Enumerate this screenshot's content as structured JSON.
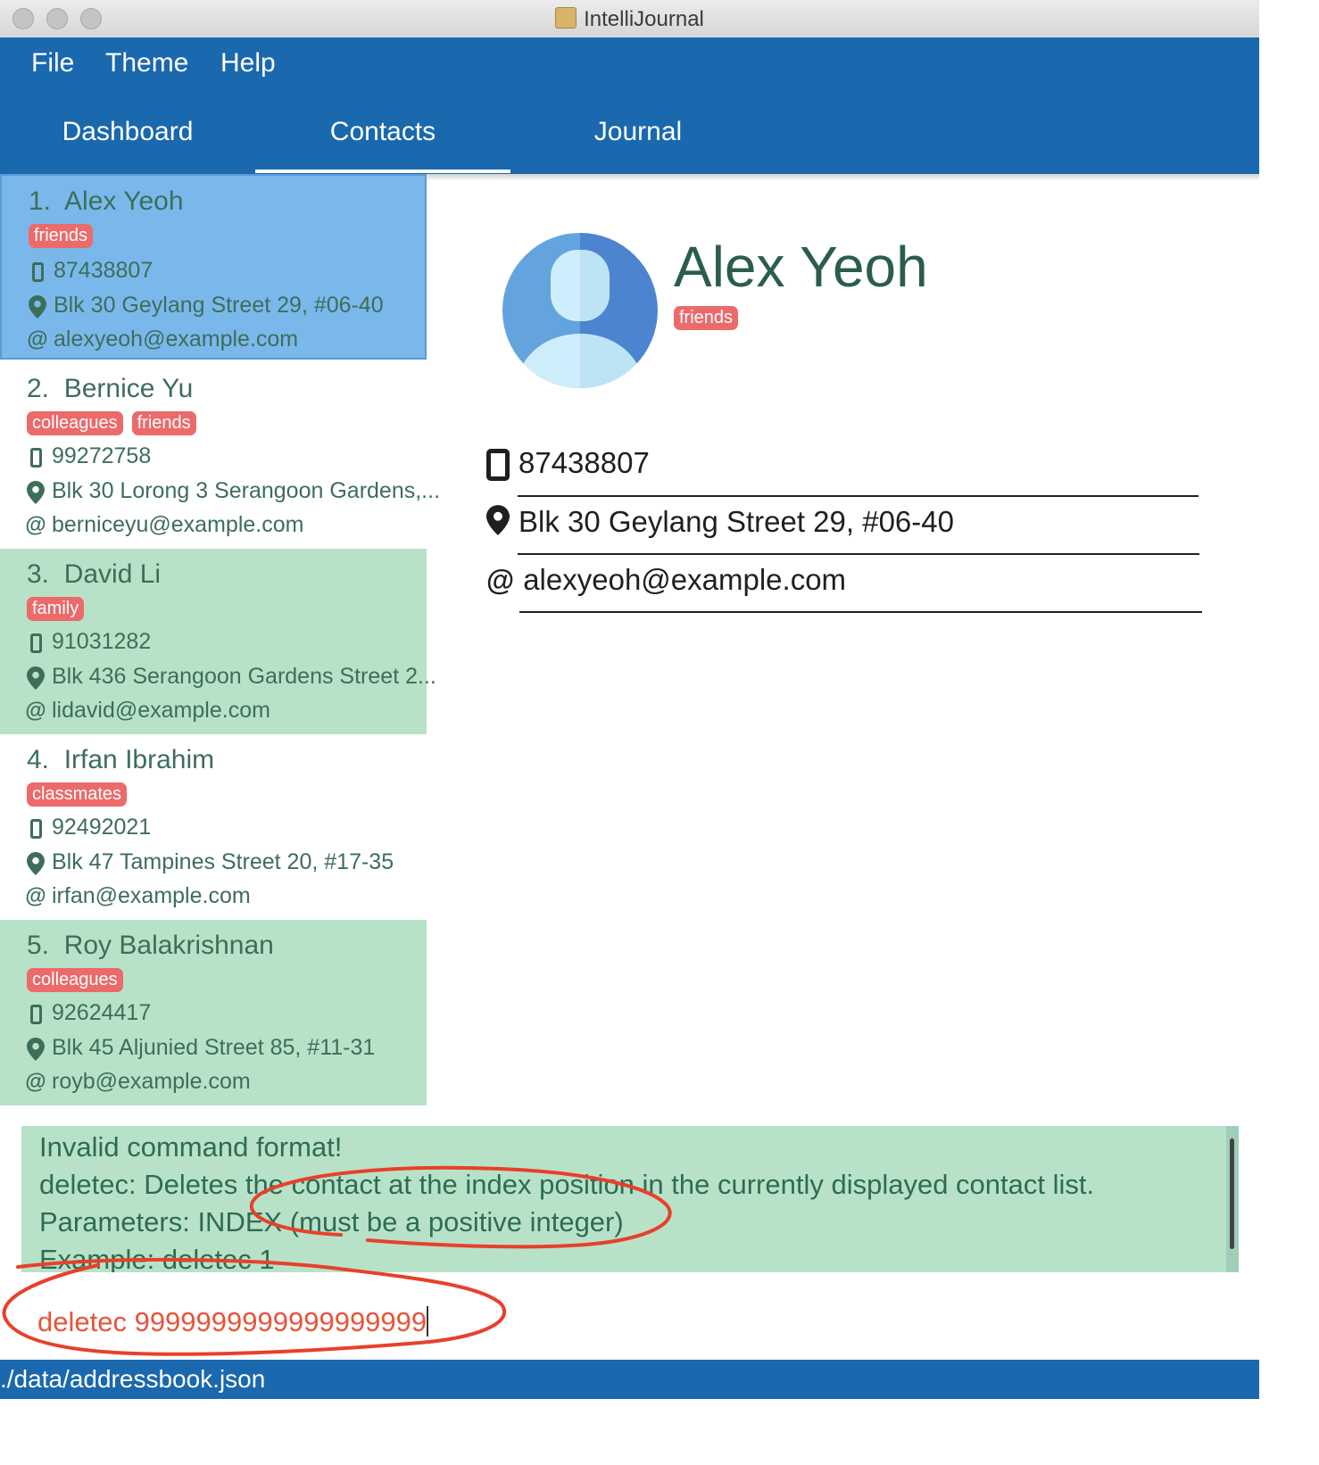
{
  "window": {
    "title": "IntelliJournal"
  },
  "menu": {
    "file": "File",
    "theme": "Theme",
    "help": "Help"
  },
  "tabs": [
    {
      "label": "Dashboard"
    },
    {
      "label": "Contacts"
    },
    {
      "label": "Journal"
    }
  ],
  "contacts": [
    {
      "index": "1.",
      "name": "Alex Yeoh",
      "tags": [
        "friends"
      ],
      "phone": "87438807",
      "address": "Blk 30 Geylang Street 29, #06-40",
      "email": "alexyeoh@example.com"
    },
    {
      "index": "2.",
      "name": "Bernice Yu",
      "tags": [
        "colleagues",
        "friends"
      ],
      "phone": "99272758",
      "address": "Blk 30 Lorong 3 Serangoon Gardens,...",
      "email": "berniceyu@example.com"
    },
    {
      "index": "3.",
      "name": "David Li",
      "tags": [
        "family"
      ],
      "phone": "91031282",
      "address": "Blk 436 Serangoon Gardens Street 2...",
      "email": "lidavid@example.com"
    },
    {
      "index": "4.",
      "name": "Irfan Ibrahim",
      "tags": [
        "classmates"
      ],
      "phone": "92492021",
      "address": "Blk 47 Tampines Street 20, #17-35",
      "email": "irfan@example.com"
    },
    {
      "index": "5.",
      "name": "Roy Balakrishnan",
      "tags": [
        "colleagues"
      ],
      "phone": "92624417",
      "address": "Blk 45 Aljunied Street 85, #11-31",
      "email": "royb@example.com"
    }
  ],
  "detail": {
    "name": "Alex Yeoh",
    "tag": "friends",
    "phone": "87438807",
    "address": "Blk 30 Geylang Street 29, #06-40",
    "email": "alexyeoh@example.com"
  },
  "result": {
    "lines": [
      "Invalid command format!",
      "deletec: Deletes the contact at the index position in the currently displayed contact list.",
      "Parameters: INDEX (must be a positive integer)",
      "Example: deletec 1"
    ]
  },
  "command": {
    "value": "deletec 9999999999999999999"
  },
  "status": {
    "path": "./data/addressbook.json"
  },
  "colors": {
    "brand": "#1a68ae",
    "tag": "#ec6a6a",
    "selected": "#7ab8ec",
    "alt_row": "#b8e2c8",
    "annotation": "#e8402a"
  },
  "icons": {
    "phone": "phone-icon",
    "address": "map-pin-icon",
    "email": "at-icon"
  }
}
